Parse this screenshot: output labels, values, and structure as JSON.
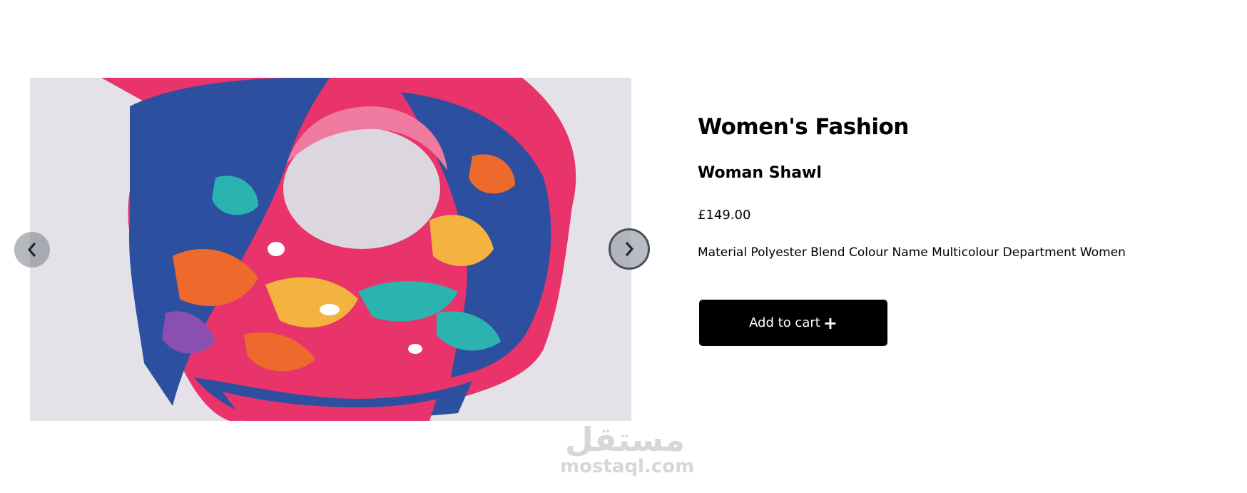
{
  "product": {
    "category": "Women's Fashion",
    "name": "Woman Shawl",
    "price": "£149.00",
    "description": "Material Polyester Blend Colour Name Multicolour Department Women",
    "add_to_cart_label": "Add to cart",
    "add_icon": "plus-icon",
    "add_icon_glyph": "+"
  },
  "gallery": {
    "image_alt": "Multicolour woman shawl",
    "prev_icon": "chevron-left-icon",
    "next_icon": "chevron-right-icon"
  },
  "watermark": {
    "arabic": "مستقل",
    "latin": "mostaql.com"
  },
  "colors": {
    "button_bg": "#000000",
    "button_text": "#ffffff",
    "scarf_pink": "#e8336b",
    "scarf_blue": "#2d4fa0",
    "scarf_orange": "#ee6a2c",
    "scarf_teal": "#2bb3b0",
    "scarf_yellow": "#f4b33e",
    "photo_bg": "#e4e2e8"
  }
}
